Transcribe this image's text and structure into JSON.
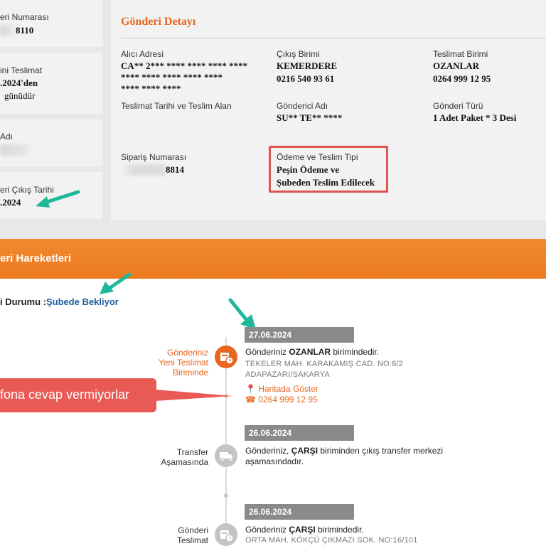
{
  "left_cards": {
    "shipment_number": {
      "label": "eri Numarası",
      "value": "8110"
    },
    "delivery": {
      "label": "ini Teslimat",
      "value": ".2024'den",
      "sub": "günüdür"
    },
    "name": {
      "label": "Adı"
    },
    "exit_date": {
      "label": "eri Çıkış Tarihi",
      "value": ".2024"
    }
  },
  "detail": {
    "title": "Gönderi Detayı",
    "recipient_address": {
      "label": "Alıcı Adresi",
      "lines": [
        "CA** 2*** **** **** **** ****",
        "**** **** **** **** ****",
        "**** **** ****"
      ]
    },
    "exit_unit": {
      "label": "Çıkış Birimi",
      "name": "KEMERDERE",
      "phone": "0216 540 93 61"
    },
    "delivery_unit": {
      "label": "Teslimat Birimi",
      "name": "OZANLAR",
      "phone": "0264 999 12 95"
    },
    "delivery_date": {
      "label": "Teslimat Tarihi ve Teslim Alan"
    },
    "sender": {
      "label": "Gönderici Adı",
      "value": "SU** TE** ****"
    },
    "shipment_type": {
      "label": "Gönderi Türü",
      "value": "1 Adet Paket * 3 Desi"
    },
    "order_number": {
      "label": "Sipariş Numarası",
      "value": "8814"
    },
    "payment": {
      "label": "Ödeme ve Teslim Tipi",
      "line1": "Peşin Ödeme ve",
      "line2": "Şubeden Teslim Edilecek"
    }
  },
  "movements": {
    "header": "eri Hareketleri",
    "status_label": "i Durumu :",
    "status_value": "Şubede Bekliyor"
  },
  "events": [
    {
      "date": "27.06.2024",
      "title_lines": [
        "Gönderiniz",
        "Yeni Teslimat",
        "Biriminde"
      ],
      "text_pre": "Gönderiniz ",
      "text_bold": "OZANLAR",
      "text_post": " birimindedir.",
      "addr1": "TEKELER MAH. KARAKAMIŞ CAD. NO:8/2",
      "addr2": "ADAPAZARI/SAKARYA",
      "map_link": "Haritada Göster",
      "phone": "0264 999 12 95"
    },
    {
      "date": "26.06.2024",
      "title_lines": [
        "Transfer",
        "Aşamasında"
      ],
      "text_pre": "Gönderiniz, ",
      "text_bold": "ÇARŞI",
      "text_post": " biriminden çıkış transfer merkezi",
      "text_line2": "aşamasındadır."
    },
    {
      "date": "26.06.2024",
      "title_lines": [
        "Gönderi",
        "Teslimat"
      ],
      "text_pre": "Gönderiniz ",
      "text_bold": "ÇARŞI",
      "text_post": " birimindedir.",
      "addr1": "ORTA MAH. KÖKÇÜ ÇIKMAZI SOK. NO:16/101"
    }
  ],
  "annotation": {
    "callout": "fona cevap vermiyorlar"
  },
  "colors": {
    "accent": "#e8661f",
    "link": "#1a5d9e",
    "annotation_red": "#e95a55",
    "arrow_teal": "#20b89a"
  }
}
